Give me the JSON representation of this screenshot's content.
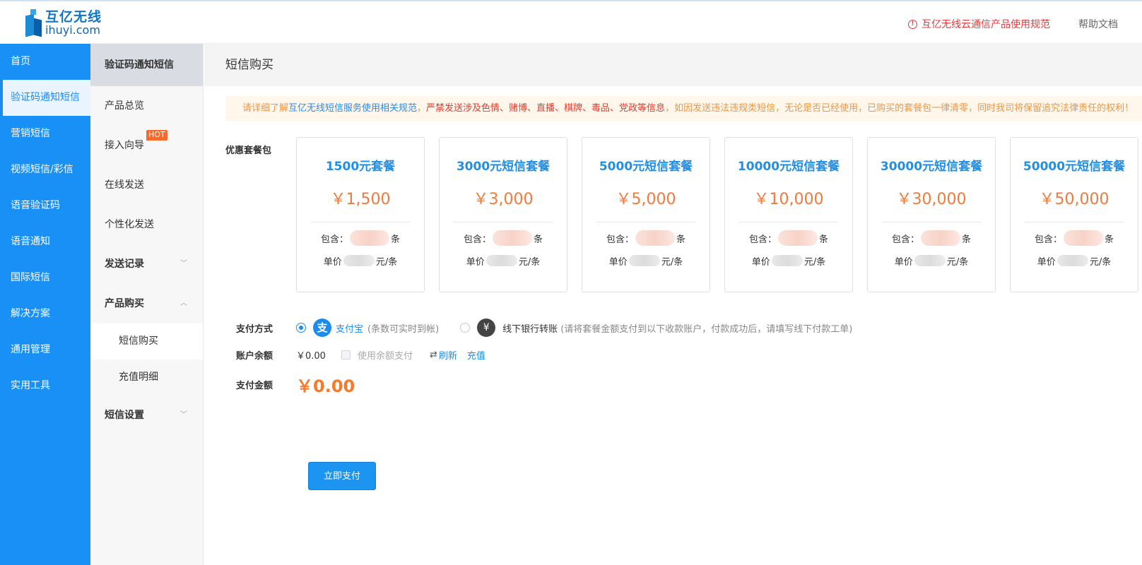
{
  "brand": {
    "name_cn": "互亿无线",
    "name_en": "ihuyi.com"
  },
  "header": {
    "notice": "互亿无线云通信产品使用规范",
    "notice_icon": "alert-circle-icon",
    "help": "帮助文档"
  },
  "nav": {
    "items": [
      {
        "label": "首页",
        "active": false
      },
      {
        "label": "验证码通知短信",
        "active": true
      },
      {
        "label": "营销短信",
        "active": false
      },
      {
        "label": "视频短信/彩信",
        "active": false
      },
      {
        "label": "语音验证码",
        "active": false
      },
      {
        "label": "语音通知",
        "active": false
      },
      {
        "label": "国际短信",
        "active": false
      },
      {
        "label": "解决方案",
        "active": false
      },
      {
        "label": "通用管理",
        "active": false
      },
      {
        "label": "实用工具",
        "active": false
      }
    ]
  },
  "subnav": {
    "title": "验证码通知短信",
    "overview": "产品总览",
    "guide": "接入向导",
    "hot_badge": "HOT",
    "online_send": "在线发送",
    "personal_send": "个性化发送",
    "send_records": "发送记录",
    "product_purchase": "产品购买",
    "sms_purchase": "短信购买",
    "recharge_detail": "充值明细",
    "sms_settings": "短信设置"
  },
  "page": {
    "title": "短信购买"
  },
  "warning": {
    "part1": "请详细了解",
    "link": "互亿无线短信服务使用相关规范",
    "part2": "，",
    "red": "严禁发送涉及色情、赌博、直播、棋牌、毒品、党政等信息",
    "part3": "，如因发送违法违规类短信，无论是否已经使用，已购买的套餐包一律清零，同时我司将保留追究法律责任的权利！"
  },
  "packages": {
    "label": "优惠套餐包",
    "contains_label": "包含：",
    "unit_count": "条",
    "unit_price_label": "单价",
    "unit_price_suffix": "元/条",
    "items": [
      {
        "name": "1500元套餐",
        "price": "￥1,500"
      },
      {
        "name": "3000元短信套餐",
        "price": "￥3,000"
      },
      {
        "name": "5000元短信套餐",
        "price": "￥5,000"
      },
      {
        "name": "10000元短信套餐",
        "price": "￥10,000"
      },
      {
        "name": "30000元短信套餐",
        "price": "￥30,000"
      },
      {
        "name": "50000元短信套餐",
        "price": "￥50,000"
      }
    ]
  },
  "payment": {
    "method_label": "支付方式",
    "alipay_label": "支付宝",
    "alipay_note": "(条数可实时到帐)",
    "bank_label": "线下银行转账",
    "bank_note": "(请将套餐金额支付到以下收款账户，付款成功后，请填写线下付款工单)",
    "balance_label": "账户余额",
    "balance_value": "￥0.00",
    "use_balance": "使用余额支付",
    "refresh": "刷新",
    "recharge": "充值",
    "amount_label": "支付金额",
    "amount_value": "￥0.00",
    "pay_button": "立即支付"
  },
  "colors": {
    "sidebar": "#1990f5",
    "accent": "#1b8bf0",
    "price": "#f07a3c",
    "danger": "#e4393c"
  }
}
